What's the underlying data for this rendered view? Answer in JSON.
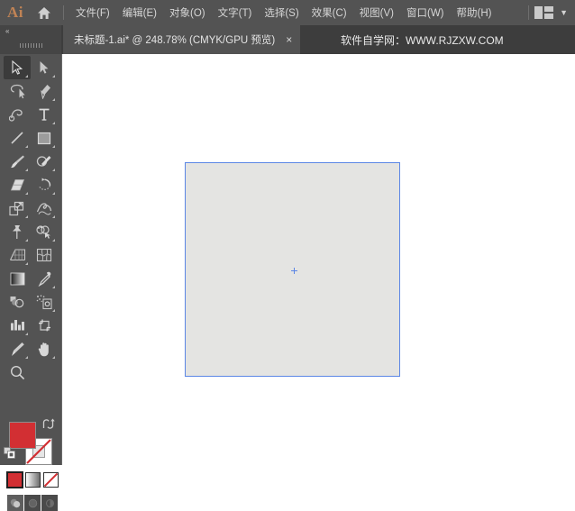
{
  "app": {
    "logo_text": "Ai",
    "logo_color": "#c08355",
    "home_icon": "home-icon",
    "workspace_icon": "workspace-switcher-icon",
    "workspace_chevron": "▼"
  },
  "menubar": {
    "items": [
      {
        "label": "文件(F)",
        "name": "menu-file"
      },
      {
        "label": "编辑(E)",
        "name": "menu-edit"
      },
      {
        "label": "对象(O)",
        "name": "menu-object"
      },
      {
        "label": "文字(T)",
        "name": "menu-type"
      },
      {
        "label": "选择(S)",
        "name": "menu-select"
      },
      {
        "label": "效果(C)",
        "name": "menu-effect"
      },
      {
        "label": "视图(V)",
        "name": "menu-view"
      },
      {
        "label": "窗口(W)",
        "name": "menu-window"
      },
      {
        "label": "帮助(H)",
        "name": "menu-help"
      }
    ]
  },
  "tabbar": {
    "document_tab": {
      "label": "未标题-1.ai* @ 248.78% (CMYK/GPU 预览)",
      "close_label": "×"
    },
    "watermark": "软件自学网：WWW.RJZXW.COM",
    "collapse_label": "«"
  },
  "toolbar": {
    "tools": [
      {
        "name": "selection-tool",
        "icon": "arrow-cursor-icon",
        "active": true,
        "has_flyout": true
      },
      {
        "name": "direct-selection-tool",
        "icon": "white-arrow-icon",
        "active": false,
        "has_flyout": true
      },
      {
        "name": "lasso-tool",
        "icon": "magic-wand-icon",
        "active": false,
        "has_flyout": false
      },
      {
        "name": "pen-tool",
        "icon": "pen-nib-icon",
        "active": false,
        "has_flyout": true
      },
      {
        "name": "curvature-tool",
        "icon": "curvature-icon",
        "active": false,
        "has_flyout": false
      },
      {
        "name": "type-tool",
        "icon": "type-T-icon",
        "active": false,
        "has_flyout": true
      },
      {
        "name": "line-segment-tool",
        "icon": "line-diagonal-icon",
        "active": false,
        "has_flyout": true
      },
      {
        "name": "rectangle-tool",
        "icon": "rectangle-icon",
        "active": false,
        "has_flyout": true
      },
      {
        "name": "paintbrush-tool",
        "icon": "paintbrush-icon",
        "active": false,
        "has_flyout": true
      },
      {
        "name": "shaper-tool",
        "icon": "shaper-pencil-icon",
        "active": false,
        "has_flyout": true
      },
      {
        "name": "eraser-tool",
        "icon": "eraser-icon",
        "active": false,
        "has_flyout": true
      },
      {
        "name": "rotate-tool",
        "icon": "rotate-arrow-icon",
        "active": false,
        "has_flyout": true
      },
      {
        "name": "scale-tool",
        "icon": "scale-squares-icon",
        "active": false,
        "has_flyout": true
      },
      {
        "name": "width-tool",
        "icon": "warp-twirl-icon",
        "active": false,
        "has_flyout": true
      },
      {
        "name": "free-transform-tool",
        "icon": "pushpin-icon",
        "active": false,
        "has_flyout": true
      },
      {
        "name": "shape-builder-tool",
        "icon": "shape-builder-icon",
        "active": false,
        "has_flyout": true
      },
      {
        "name": "perspective-grid-tool",
        "icon": "perspective-grid-icon",
        "active": false,
        "has_flyout": true
      },
      {
        "name": "mesh-tool",
        "icon": "mesh-net-icon",
        "active": false,
        "has_flyout": false
      },
      {
        "name": "gradient-tool",
        "icon": "gradient-square-icon",
        "active": false,
        "has_flyout": false
      },
      {
        "name": "eyedropper-tool",
        "icon": "eyedropper-icon",
        "active": false,
        "has_flyout": true
      },
      {
        "name": "blend-tool",
        "icon": "blend-shapes-icon",
        "active": false,
        "has_flyout": false
      },
      {
        "name": "symbol-sprayer-tool",
        "icon": "symbol-sprayer-icon",
        "active": false,
        "has_flyout": true
      },
      {
        "name": "column-graph-tool",
        "icon": "bar-chart-icon",
        "active": false,
        "has_flyout": true
      },
      {
        "name": "artboard-tool",
        "icon": "artboard-crop-icon",
        "active": false,
        "has_flyout": false
      },
      {
        "name": "slice-tool",
        "icon": "slice-knife-icon",
        "active": false,
        "has_flyout": true
      },
      {
        "name": "hand-tool",
        "icon": "hand-icon",
        "active": false,
        "has_flyout": true
      },
      {
        "name": "zoom-tool",
        "icon": "magnifier-icon",
        "active": false,
        "has_flyout": false
      }
    ],
    "swatches": {
      "fill_color": "#d22f33",
      "stroke_color": "#ffffff",
      "stroke_is_none": true,
      "swap_icon": "swap-fill-stroke-icon",
      "default_icon": "default-fill-stroke-icon"
    },
    "mode_buttons": [
      {
        "name": "color-mode-button",
        "icon": "color-swatch-icon",
        "selected": true
      },
      {
        "name": "gradient-mode-button",
        "icon": "gradient-swatch-icon",
        "selected": false
      },
      {
        "name": "none-mode-button",
        "icon": "none-swatch-icon",
        "selected": false
      }
    ],
    "draw_buttons": [
      {
        "name": "draw-normal-button",
        "icon": "draw-normal-icon",
        "selected": true
      },
      {
        "name": "draw-behind-button",
        "icon": "draw-behind-icon",
        "selected": false
      },
      {
        "name": "draw-inside-button",
        "icon": "draw-inside-icon",
        "selected": false
      }
    ]
  },
  "canvas": {
    "background_color": "#ffffff",
    "artboard": {
      "fill_color": "#e4e4e2",
      "border_color": "#5b86e5",
      "center_marker": "artboard-center-marker"
    }
  }
}
